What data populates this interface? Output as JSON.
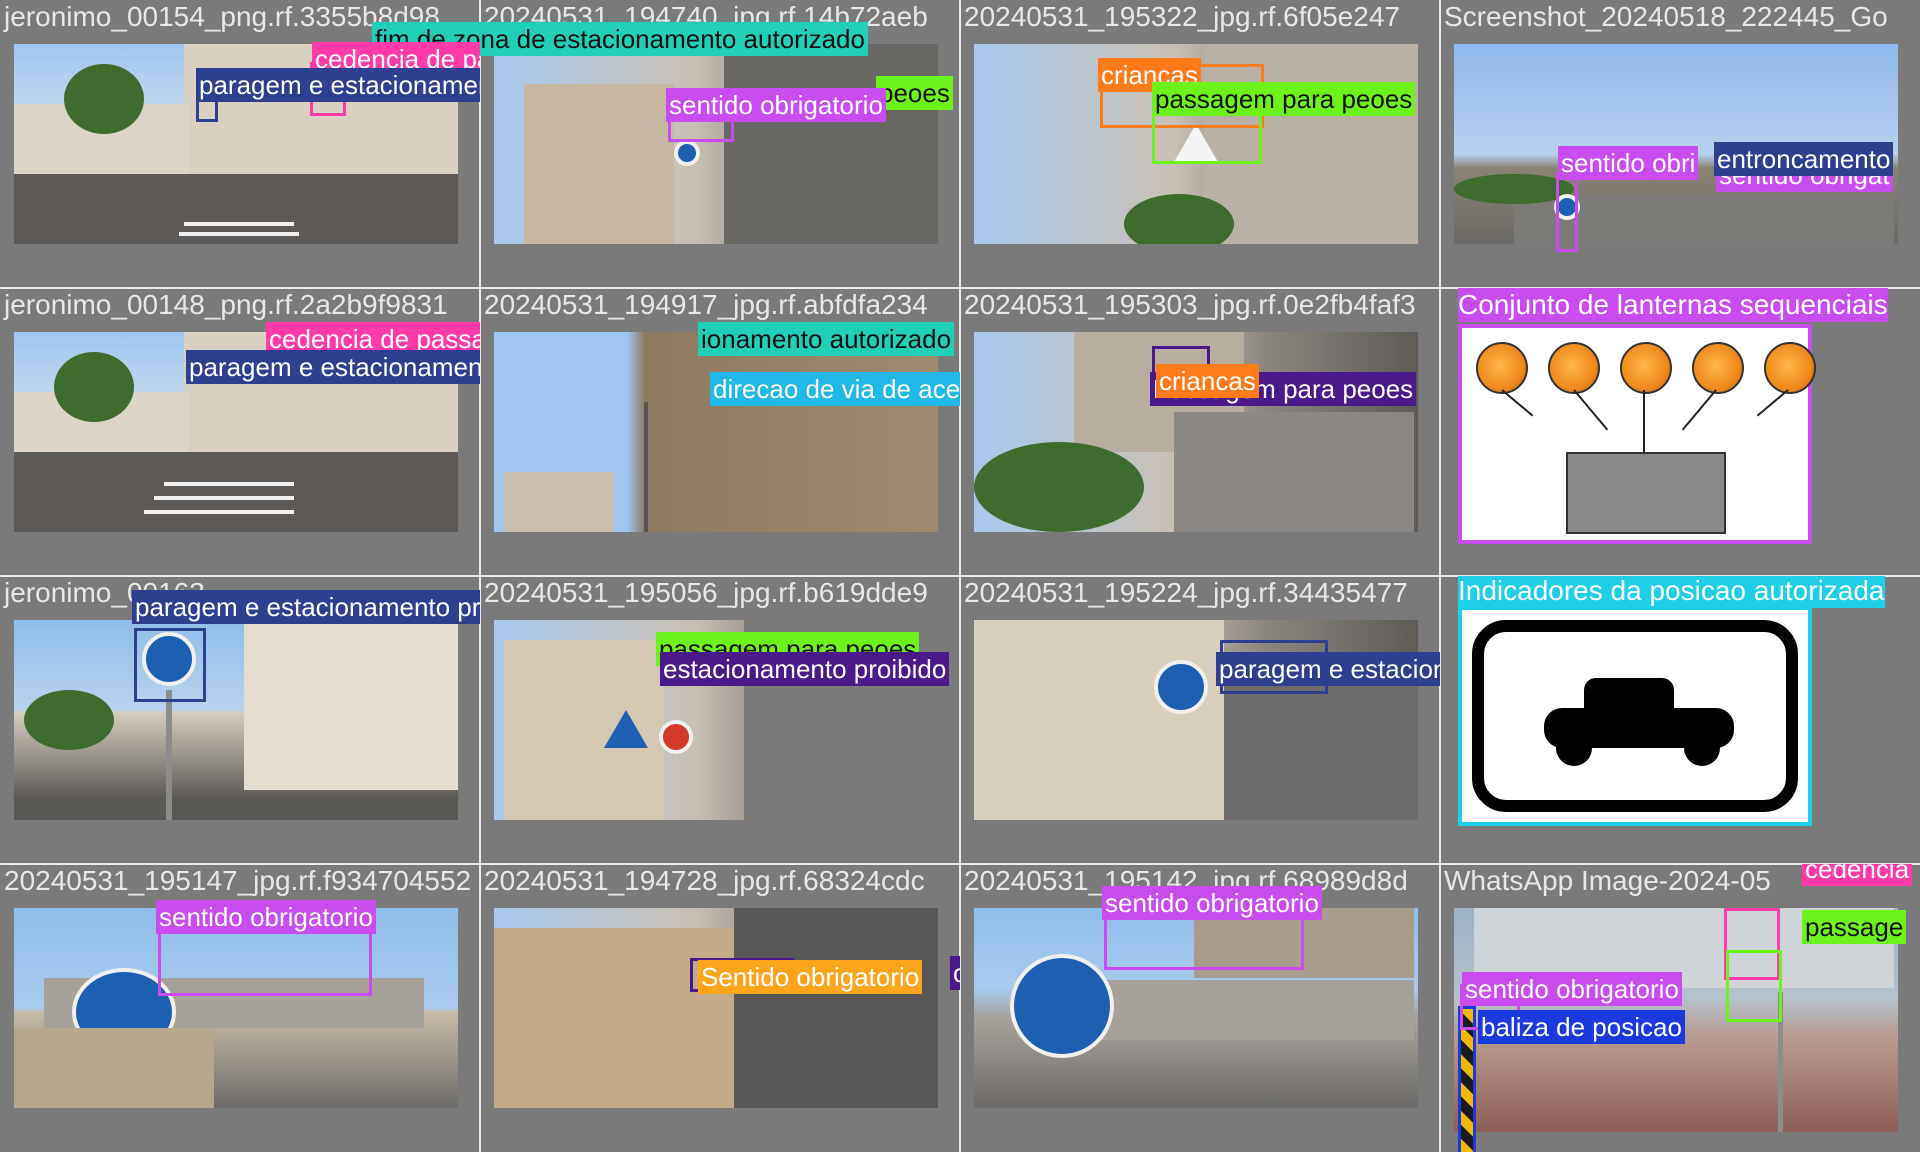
{
  "cells": [
    {
      "title": "jeronimo_00154_png.rf.3355b8d98",
      "labels": [
        {
          "text": "fim de zona de estacionamento autorizado",
          "color": "#1fcfb8"
        },
        {
          "text": "cedencia de passagem",
          "color": "#ff3aa9"
        },
        {
          "text": "paragem e estacionamento proibido",
          "color": "#2f3f8f"
        }
      ]
    },
    {
      "title": "20240531_194740_jpg.rf.14b72aeb",
      "labels": [
        {
          "text": "peoes",
          "color": "#6ef21c"
        },
        {
          "text": "sentido obrigatorio",
          "color": "#c84cf0"
        }
      ]
    },
    {
      "title": "20240531_195322_jpg.rf.6f05e247",
      "labels": [
        {
          "text": "criancas",
          "color": "#ff7a18"
        },
        {
          "text": "passagem para peoes",
          "color": "#6ef21c"
        }
      ]
    },
    {
      "title": "Screenshot_20240518_222445_Go",
      "labels": [
        {
          "text": "sentido obri",
          "color": "#c84cf0"
        },
        {
          "text": "entroncamento",
          "color": "#2f3f8f"
        },
        {
          "text": "sentido obrigat",
          "color": "#c84cf0"
        }
      ]
    },
    {
      "title": "jeronimo_00148_png.rf.2a2b9f9831",
      "labels": [
        {
          "text": "cedencia de passagem",
          "color": "#ff3aa9"
        },
        {
          "text": "paragem e estacionamento proibido",
          "color": "#2f3f8f"
        }
      ]
    },
    {
      "title": "20240531_194917_jpg.rf.abfdfa234",
      "labels": [
        {
          "text": "ionamento autorizado",
          "color": "#1fcfb8"
        },
        {
          "text": "direcao de via de acesso",
          "color": "#1fb8e8"
        }
      ]
    },
    {
      "title": "20240531_195303_jpg.rf.0e2fb4faf3",
      "labels": [
        {
          "text": "criancas",
          "color": "#ff7a18"
        },
        {
          "text": "Passagem para peoes",
          "color": "#4a1a8a"
        }
      ]
    },
    {
      "title": "Conjunto de lanternas sequenciais",
      "labels": []
    },
    {
      "title": "jeronimo_00163",
      "labels": [
        {
          "text": "paragem e estacionamento proibido",
          "color": "#2f3f8f"
        }
      ]
    },
    {
      "title": "20240531_195056_jpg.rf.b619dde9",
      "labels": [
        {
          "text": "passagem para peoes",
          "color": "#6ef21c"
        },
        {
          "text": "estacionamento proibido",
          "color": "#4a1a8a"
        }
      ]
    },
    {
      "title": "20240531_195224_jpg.rf.34435477",
      "labels": [
        {
          "text": "paragem e estacionamento proibido",
          "color": "#2f3f8f"
        }
      ]
    },
    {
      "title": "Indicadores da posicao autorizada",
      "labels": []
    },
    {
      "title": "20240531_195147_jpg.rf.f934704552",
      "labels": [
        {
          "text": "sentido obrigatorio",
          "color": "#c84cf0"
        }
      ]
    },
    {
      "title": "20240531_194728_jpg.rf.68324cdc",
      "labels": [
        {
          "text": "Sentido obrigatorio",
          "color": "#ffa51c"
        },
        {
          "text": "oes",
          "color": "#4a1a8a"
        }
      ]
    },
    {
      "title": "20240531_195142_jpg.rf.68989d8d",
      "labels": [
        {
          "text": "sentido obrigatorio",
          "color": "#c84cf0"
        }
      ]
    },
    {
      "title": "WhatsApp Image-2024-05",
      "labels": [
        {
          "text": "cedencia",
          "color": "#ff3aa9"
        },
        {
          "text": "passage",
          "color": "#6ef21c"
        },
        {
          "text": "sentido obrigatorio",
          "color": "#c84cf0"
        },
        {
          "text": "baliza de posicao",
          "color": "#1a3ae0"
        }
      ]
    }
  ]
}
